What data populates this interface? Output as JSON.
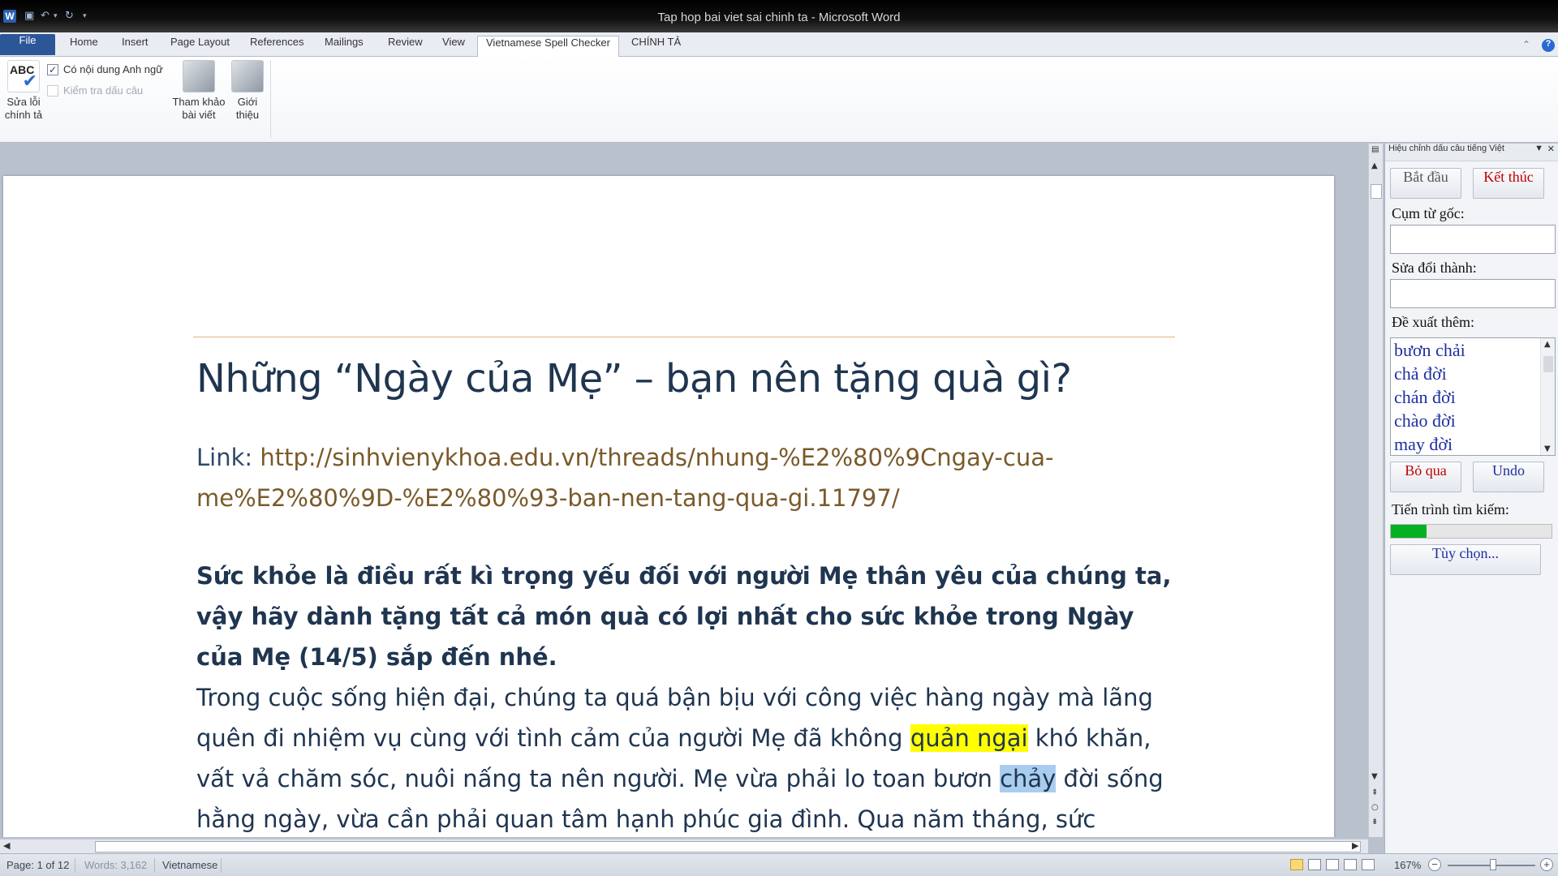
{
  "window": {
    "title": "Tap hop bai viet sai chinh ta  -  Microsoft Word",
    "app_icon_letter": "W"
  },
  "tabs": [
    {
      "label": "File"
    },
    {
      "label": "Home"
    },
    {
      "label": "Insert"
    },
    {
      "label": "Page Layout"
    },
    {
      "label": "References"
    },
    {
      "label": "Mailings"
    },
    {
      "label": "Review"
    },
    {
      "label": "View"
    },
    {
      "label": "Vietnamese Spell Checker"
    },
    {
      "label": "CHÍNH TẢ"
    }
  ],
  "ribbon": {
    "spell_fix": {
      "line1": "Sửa lỗi",
      "line2": "chính tả",
      "icon_text": "ABC",
      "icon": "spellcheck-icon"
    },
    "english_content": {
      "label": "Có nội dung Anh ngữ",
      "checked": true
    },
    "punctuation_check": {
      "label": "Kiểm tra dấu câu",
      "checked": false
    },
    "reference": {
      "line1": "Tham khảo",
      "line2": "bài viết",
      "icon": "hand-keyboard-icon"
    },
    "about": {
      "line1": "Giới",
      "line2": "thiệu",
      "icon": "hand-keyboard-icon"
    }
  },
  "document": {
    "title": "Những “Ngày của Mẹ” – bạn nên tặng quà gì?",
    "link_label": "Link: ",
    "link_url": "http://sinhvienykhoa.edu.vn/threads/nhung-%E2%80%9Cngay-cua-me%E2%80%9D-%E2%80%93-ban-nen-tang-qua-gi.11797/",
    "bold_paragraph": "Sức khỏe là điều rất kì trọng yếu đối với người Mẹ thân yêu của chúng ta, vậy hãy dành tặng tất cả món quà có lợi nhất cho sức khỏe trong Ngày của Mẹ (14/5) sắp đến nhé.",
    "body_part1": "Trong cuộc sống hiện đại, chúng ta quá bận bịu với công việc hàng ngày mà lãng quên đi nhiệm vụ cùng với tình cảm của người Mẹ đã không ",
    "body_highlight": "quản ngại",
    "body_part2": " khó khăn, vất vả chăm sóc, nuôi nấng ta nên người. Mẹ vừa phải lo toan bươn ",
    "body_selected": "chảy",
    "body_part3": " đời sống hằng ngày, vừa cần phải quan tâm hạnh phúc gia đình. Qua năm tháng, sức"
  },
  "pane": {
    "title": "Hiệu chỉnh dấu câu tiếng Việt",
    "start_button": "Bắt đầu",
    "end_button": "Kết thúc",
    "original_label": "Cụm từ gốc:",
    "original_value": "",
    "replace_label": "Sửa đổi thành:",
    "replace_value": "",
    "suggest_label": "Đề xuất thêm:",
    "suggestions": [
      "bươn chải",
      "chả đời",
      "chán đời",
      "chào đời",
      "may đời"
    ],
    "skip_button": "Bỏ qua",
    "undo_button": "Undo",
    "progress_label": "Tiến trình tìm kiếm:",
    "progress": 0.22,
    "options_button": "Tùy chọn..."
  },
  "status": {
    "page": "Page: 1 of 12",
    "words": "Words: 3,162",
    "language": "Vietnamese",
    "zoom": "167%"
  },
  "colors": {
    "file_tab": "#2b5797",
    "link": "#7a5a2a",
    "heading": "#1f3550",
    "highlight": "#ffff00",
    "selection": "#a9cdef",
    "progress_fill": "#06b025",
    "pane_button_red": "#c00000",
    "pane_button_blue": "#1d2fa0"
  }
}
